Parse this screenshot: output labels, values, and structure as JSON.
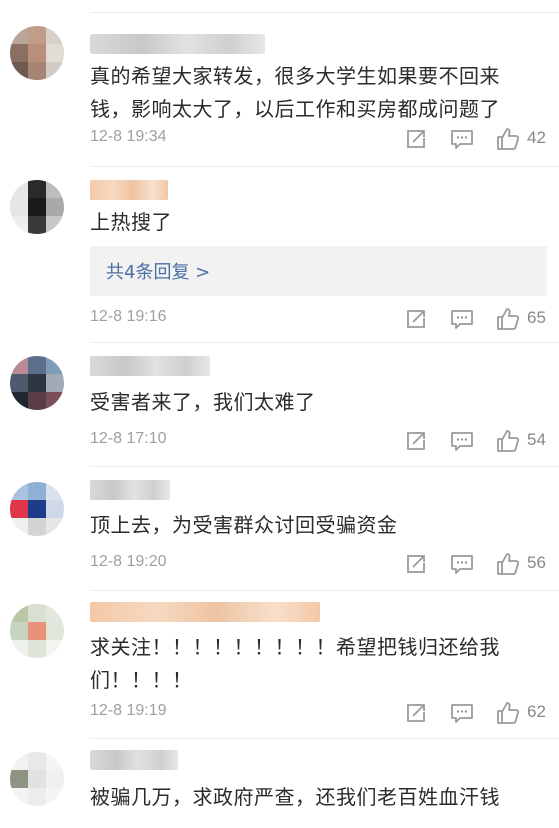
{
  "comments": [
    {
      "text": "真的希望大家转发，很多大学生如果要不回来钱，影响太大了，以后工作和买房都成问题了",
      "time": "12-8 19:34",
      "likes": "42",
      "avatar_colors": [
        "#b9a59a",
        "#c29c8a",
        "#d8cfc8",
        "#8a6f62",
        "#b98f7c",
        "#e2dcd7",
        "#6e584f",
        "#a68576",
        "#d4cbc5"
      ]
    },
    {
      "text": "上热搜了",
      "time": "12-8 19:16",
      "likes": "65",
      "replies": "共4条回复 >",
      "avatar_colors": [
        "#e6e6e6",
        "#2a2a2a",
        "#bdbdbd",
        "#e6e6e6",
        "#1a1a1a",
        "#a9a9a9",
        "#eeeeee",
        "#3a3a3a",
        "#c8c8c8"
      ]
    },
    {
      "text": "受害者来了，我们太难了",
      "time": "12-8 17:10",
      "likes": "54",
      "avatar_colors": [
        "#b98a96",
        "#5b6f8c",
        "#7e9bb8",
        "#4d5a6e",
        "#2e3440",
        "#a3a9b5",
        "#1f2733",
        "#5a3d48",
        "#7a4f5a"
      ]
    },
    {
      "text": "顶上去，为受害群众讨回受骗资金",
      "time": "12-8 19:20",
      "likes": "56",
      "avatar_colors": [
        "#a8c3df",
        "#8fb0d6",
        "#d8e2ee",
        "#e0364a",
        "#1f3c88",
        "#cfd8e8",
        "#f0f0f0",
        "#d4d4d4",
        "#e6e6e6"
      ]
    },
    {
      "text": "求关注！！！！！！！！！希望把钱归还给我们！！！！",
      "time": "12-8 19:19",
      "likes": "62",
      "avatar_colors": [
        "#b7c7a8",
        "#d9e0d2",
        "#e3e8de",
        "#c9d4be",
        "#e8927a",
        "#e0e6da",
        "#eef1eb",
        "#dfe5d8",
        "#f2f4f0"
      ]
    },
    {
      "text": "被骗几万，求政府严查，还我们老百姓血汗钱",
      "time": "",
      "likes": "",
      "avatar_colors": [
        "#f1f1f1",
        "#e8e8e8",
        "#f4f4f4",
        "#8e9482",
        "#e2e2e2",
        "#f0f0f0",
        "#f3f3f3",
        "#ececec",
        "#f5f5f5"
      ]
    }
  ]
}
